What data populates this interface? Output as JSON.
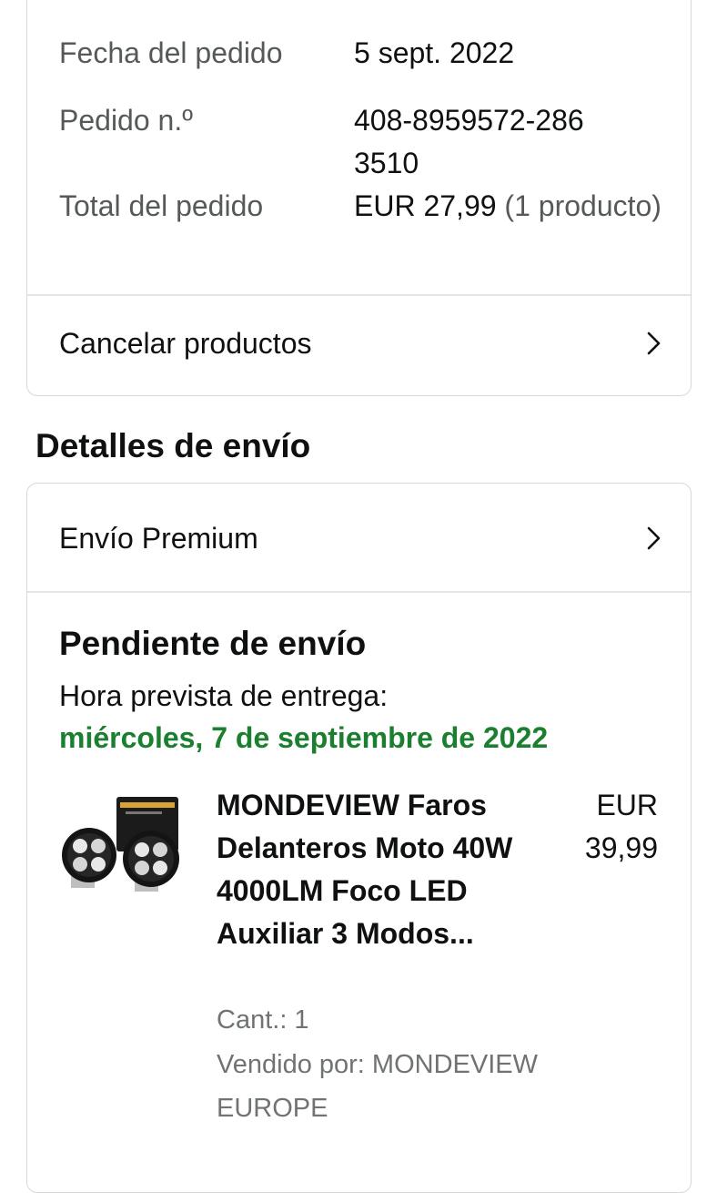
{
  "order": {
    "date_label": "Fecha del pedido",
    "date_value": "5 sept. 2022",
    "number_label": "Pedido n.º",
    "number_value": "408-8959572-2863510",
    "total_label": "Total del pedido",
    "total_amount": "EUR 27,99",
    "total_count": "(1 producto)",
    "cancel_label": "Cancelar productos"
  },
  "shipping": {
    "section_title": "Detalles de envío",
    "method_label": "Envío Premium",
    "status_title": "Pendiente de envío",
    "delivery_label": "Hora prevista de entrega:",
    "delivery_date": "miércoles, 7 de septiembre de 2022",
    "delivery_color": "#1a7f2e"
  },
  "product": {
    "title": "MONDEVIEW Faros Delanteros Moto 40W 4000LM Foco LED Auxiliar 3 Modos...",
    "price_currency": "EUR",
    "price_value": "39,99",
    "quantity": "Cant.: 1",
    "seller": "Vendido por: MONDEVIEW EUROPE",
    "image_icon": "led-headlight-product-image"
  },
  "icons": {
    "chevron": "chevron-right-icon"
  }
}
